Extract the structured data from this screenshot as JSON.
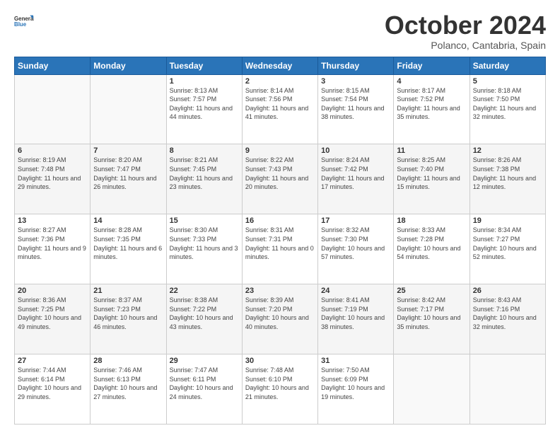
{
  "logo": {
    "line1": "General",
    "line2": "Blue"
  },
  "title": "October 2024",
  "subtitle": "Polanco, Cantabria, Spain",
  "headers": [
    "Sunday",
    "Monday",
    "Tuesday",
    "Wednesday",
    "Thursday",
    "Friday",
    "Saturday"
  ],
  "weeks": [
    [
      {
        "day": "",
        "info": ""
      },
      {
        "day": "",
        "info": ""
      },
      {
        "day": "1",
        "info": "Sunrise: 8:13 AM\nSunset: 7:57 PM\nDaylight: 11 hours and 44 minutes."
      },
      {
        "day": "2",
        "info": "Sunrise: 8:14 AM\nSunset: 7:56 PM\nDaylight: 11 hours and 41 minutes."
      },
      {
        "day": "3",
        "info": "Sunrise: 8:15 AM\nSunset: 7:54 PM\nDaylight: 11 hours and 38 minutes."
      },
      {
        "day": "4",
        "info": "Sunrise: 8:17 AM\nSunset: 7:52 PM\nDaylight: 11 hours and 35 minutes."
      },
      {
        "day": "5",
        "info": "Sunrise: 8:18 AM\nSunset: 7:50 PM\nDaylight: 11 hours and 32 minutes."
      }
    ],
    [
      {
        "day": "6",
        "info": "Sunrise: 8:19 AM\nSunset: 7:48 PM\nDaylight: 11 hours and 29 minutes."
      },
      {
        "day": "7",
        "info": "Sunrise: 8:20 AM\nSunset: 7:47 PM\nDaylight: 11 hours and 26 minutes."
      },
      {
        "day": "8",
        "info": "Sunrise: 8:21 AM\nSunset: 7:45 PM\nDaylight: 11 hours and 23 minutes."
      },
      {
        "day": "9",
        "info": "Sunrise: 8:22 AM\nSunset: 7:43 PM\nDaylight: 11 hours and 20 minutes."
      },
      {
        "day": "10",
        "info": "Sunrise: 8:24 AM\nSunset: 7:42 PM\nDaylight: 11 hours and 17 minutes."
      },
      {
        "day": "11",
        "info": "Sunrise: 8:25 AM\nSunset: 7:40 PM\nDaylight: 11 hours and 15 minutes."
      },
      {
        "day": "12",
        "info": "Sunrise: 8:26 AM\nSunset: 7:38 PM\nDaylight: 11 hours and 12 minutes."
      }
    ],
    [
      {
        "day": "13",
        "info": "Sunrise: 8:27 AM\nSunset: 7:36 PM\nDaylight: 11 hours and 9 minutes."
      },
      {
        "day": "14",
        "info": "Sunrise: 8:28 AM\nSunset: 7:35 PM\nDaylight: 11 hours and 6 minutes."
      },
      {
        "day": "15",
        "info": "Sunrise: 8:30 AM\nSunset: 7:33 PM\nDaylight: 11 hours and 3 minutes."
      },
      {
        "day": "16",
        "info": "Sunrise: 8:31 AM\nSunset: 7:31 PM\nDaylight: 11 hours and 0 minutes."
      },
      {
        "day": "17",
        "info": "Sunrise: 8:32 AM\nSunset: 7:30 PM\nDaylight: 10 hours and 57 minutes."
      },
      {
        "day": "18",
        "info": "Sunrise: 8:33 AM\nSunset: 7:28 PM\nDaylight: 10 hours and 54 minutes."
      },
      {
        "day": "19",
        "info": "Sunrise: 8:34 AM\nSunset: 7:27 PM\nDaylight: 10 hours and 52 minutes."
      }
    ],
    [
      {
        "day": "20",
        "info": "Sunrise: 8:36 AM\nSunset: 7:25 PM\nDaylight: 10 hours and 49 minutes."
      },
      {
        "day": "21",
        "info": "Sunrise: 8:37 AM\nSunset: 7:23 PM\nDaylight: 10 hours and 46 minutes."
      },
      {
        "day": "22",
        "info": "Sunrise: 8:38 AM\nSunset: 7:22 PM\nDaylight: 10 hours and 43 minutes."
      },
      {
        "day": "23",
        "info": "Sunrise: 8:39 AM\nSunset: 7:20 PM\nDaylight: 10 hours and 40 minutes."
      },
      {
        "day": "24",
        "info": "Sunrise: 8:41 AM\nSunset: 7:19 PM\nDaylight: 10 hours and 38 minutes."
      },
      {
        "day": "25",
        "info": "Sunrise: 8:42 AM\nSunset: 7:17 PM\nDaylight: 10 hours and 35 minutes."
      },
      {
        "day": "26",
        "info": "Sunrise: 8:43 AM\nSunset: 7:16 PM\nDaylight: 10 hours and 32 minutes."
      }
    ],
    [
      {
        "day": "27",
        "info": "Sunrise: 7:44 AM\nSunset: 6:14 PM\nDaylight: 10 hours and 29 minutes."
      },
      {
        "day": "28",
        "info": "Sunrise: 7:46 AM\nSunset: 6:13 PM\nDaylight: 10 hours and 27 minutes."
      },
      {
        "day": "29",
        "info": "Sunrise: 7:47 AM\nSunset: 6:11 PM\nDaylight: 10 hours and 24 minutes."
      },
      {
        "day": "30",
        "info": "Sunrise: 7:48 AM\nSunset: 6:10 PM\nDaylight: 10 hours and 21 minutes."
      },
      {
        "day": "31",
        "info": "Sunrise: 7:50 AM\nSunset: 6:09 PM\nDaylight: 10 hours and 19 minutes."
      },
      {
        "day": "",
        "info": ""
      },
      {
        "day": "",
        "info": ""
      }
    ]
  ]
}
